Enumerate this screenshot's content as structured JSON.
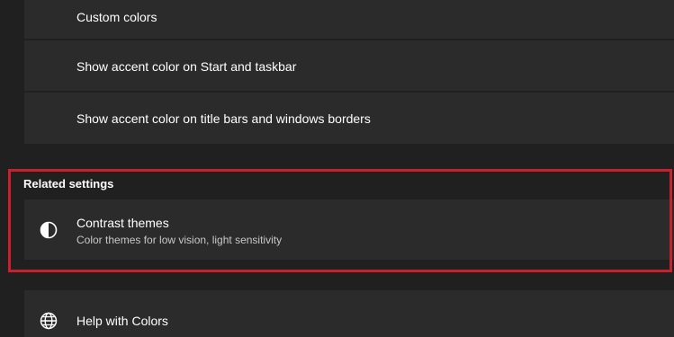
{
  "colors_section": {
    "items": [
      {
        "label": "Custom colors"
      },
      {
        "label": "Show accent color on Start and taskbar"
      },
      {
        "label": "Show accent color on title bars and windows borders"
      }
    ]
  },
  "related_settings": {
    "title": "Related settings",
    "contrast_themes": {
      "label": "Contrast themes",
      "description": "Color themes for low vision, light sensitivity",
      "icon": "contrast-icon"
    }
  },
  "help": {
    "label": "Help with Colors",
    "icon": "globe-icon"
  },
  "colors": {
    "background": "#202020",
    "card": "#2b2b2b",
    "highlight_border": "#c9202c"
  }
}
